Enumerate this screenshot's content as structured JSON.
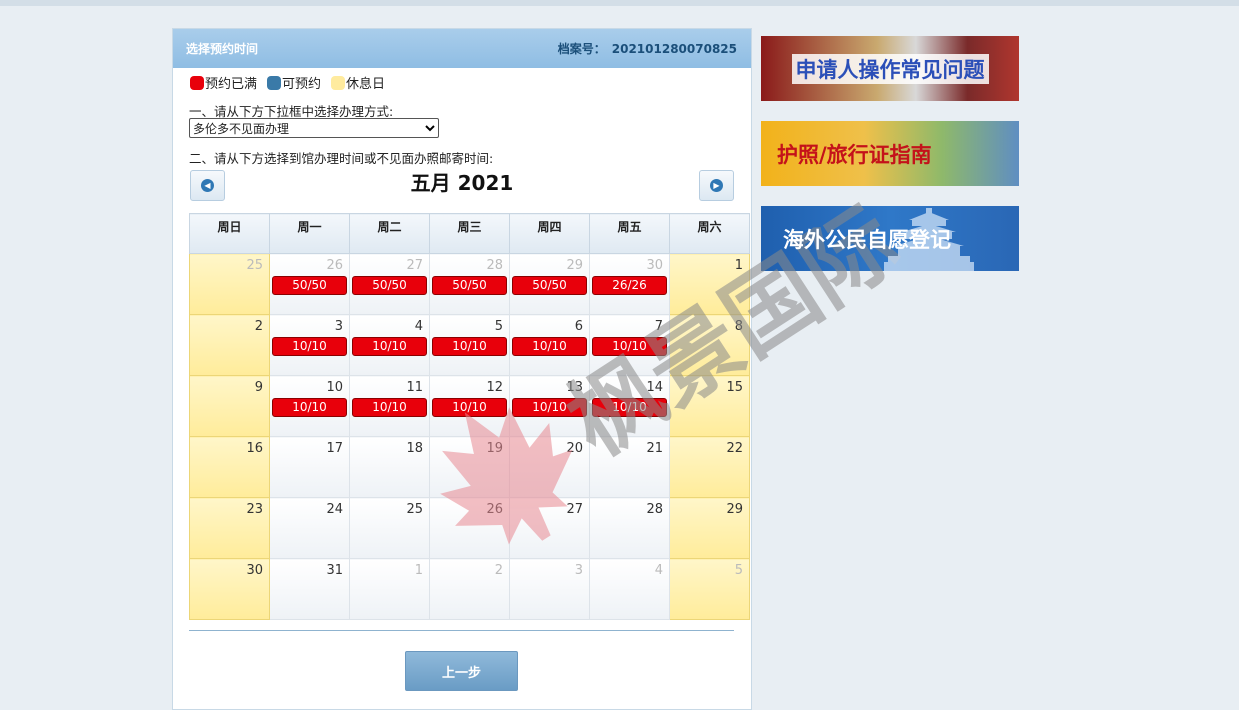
{
  "header": {
    "title": "选择预约时间",
    "case_label": "档案号：",
    "case_number": "202101280070825"
  },
  "legend": [
    {
      "label": "预约已满",
      "color": "#e8000b"
    },
    {
      "label": "可预约",
      "color": "#3a7aa8"
    },
    {
      "label": "休息日",
      "color": "#ffeb9e"
    }
  ],
  "step1": {
    "text": "一、请从下方下拉框中选择办理方式:",
    "selected": "多伦多不见面办理"
  },
  "step2": {
    "text": "二、请从下方选择到馆办理时间或不见面办照邮寄时间:"
  },
  "calendar": {
    "month_title": "五月 2021",
    "weekdays": [
      "周日",
      "周一",
      "周二",
      "周三",
      "周四",
      "周五",
      "周六"
    ],
    "weeks": [
      [
        {
          "d": "25",
          "o": 1,
          "w": 1
        },
        {
          "d": "26",
          "o": 1,
          "s": "50/50"
        },
        {
          "d": "27",
          "o": 1,
          "s": "50/50"
        },
        {
          "d": "28",
          "o": 1,
          "s": "50/50"
        },
        {
          "d": "29",
          "o": 1,
          "s": "50/50"
        },
        {
          "d": "30",
          "o": 1,
          "s": "26/26"
        },
        {
          "d": "1",
          "w": 1
        }
      ],
      [
        {
          "d": "2",
          "w": 1
        },
        {
          "d": "3",
          "s": "10/10"
        },
        {
          "d": "4",
          "s": "10/10"
        },
        {
          "d": "5",
          "s": "10/10"
        },
        {
          "d": "6",
          "s": "10/10"
        },
        {
          "d": "7",
          "s": "10/10"
        },
        {
          "d": "8",
          "w": 1
        }
      ],
      [
        {
          "d": "9",
          "w": 1
        },
        {
          "d": "10",
          "s": "10/10"
        },
        {
          "d": "11",
          "s": "10/10"
        },
        {
          "d": "12",
          "s": "10/10"
        },
        {
          "d": "13",
          "s": "10/10"
        },
        {
          "d": "14",
          "s": "10/10"
        },
        {
          "d": "15",
          "w": 1
        }
      ],
      [
        {
          "d": "16",
          "w": 1
        },
        {
          "d": "17"
        },
        {
          "d": "18"
        },
        {
          "d": "19"
        },
        {
          "d": "20"
        },
        {
          "d": "21"
        },
        {
          "d": "22",
          "w": 1
        }
      ],
      [
        {
          "d": "23",
          "w": 1
        },
        {
          "d": "24"
        },
        {
          "d": "25"
        },
        {
          "d": "26"
        },
        {
          "d": "27"
        },
        {
          "d": "28"
        },
        {
          "d": "29",
          "w": 1
        }
      ],
      [
        {
          "d": "30",
          "w": 1
        },
        {
          "d": "31"
        },
        {
          "d": "1",
          "o": 1
        },
        {
          "d": "2",
          "o": 1
        },
        {
          "d": "3",
          "o": 1
        },
        {
          "d": "4",
          "o": 1
        },
        {
          "d": "5",
          "o": 1,
          "w": 1
        }
      ]
    ]
  },
  "buttons": {
    "prev": "上一步"
  },
  "banners": [
    {
      "text": "申请人操作常见问题"
    },
    {
      "text": "护照/旅行证指南"
    },
    {
      "text": "海外公民自愿登记"
    }
  ],
  "watermark": {
    "text": "枫景国际"
  }
}
